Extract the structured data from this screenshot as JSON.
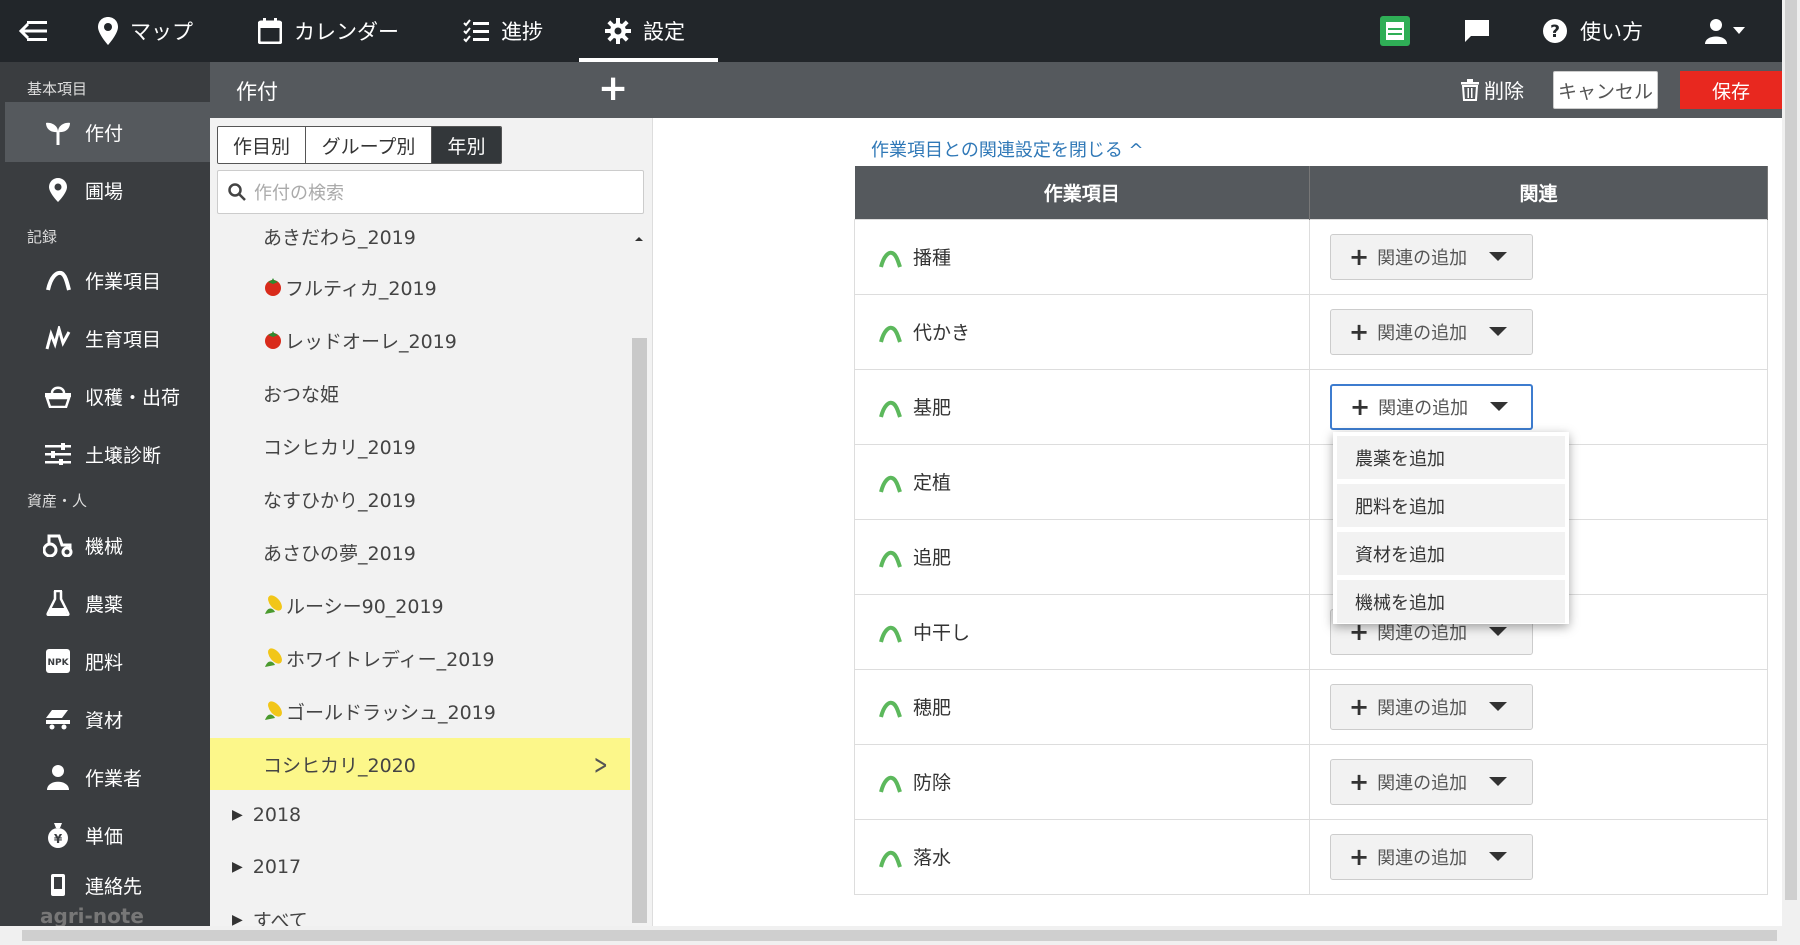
{
  "topbar": {
    "nav": [
      {
        "label": "マップ",
        "icon": "map-pin-icon"
      },
      {
        "label": "カレンダー",
        "icon": "calendar-icon"
      },
      {
        "label": "進捗",
        "icon": "checklist-icon"
      },
      {
        "label": "設定",
        "icon": "gear-icon"
      }
    ],
    "help_label": "使い方"
  },
  "sidebar": {
    "section_basic": "基本項目",
    "section_records": "記録",
    "section_assets": "資産・人",
    "items": [
      {
        "label": "作付",
        "icon": "sprout-icon"
      },
      {
        "label": "圃場",
        "icon": "location-icon"
      },
      {
        "label": "作業項目",
        "icon": "work-icon"
      },
      {
        "label": "生育項目",
        "icon": "growth-icon"
      },
      {
        "label": "収穫・出荷",
        "icon": "basket-icon"
      },
      {
        "label": "土壌診断",
        "icon": "sliders-icon"
      },
      {
        "label": "機械",
        "icon": "tractor-icon"
      },
      {
        "label": "農薬",
        "icon": "flask-icon"
      },
      {
        "label": "肥料",
        "icon": "npk-icon"
      },
      {
        "label": "資材",
        "icon": "material-icon"
      },
      {
        "label": "作業者",
        "icon": "person-icon"
      },
      {
        "label": "単価",
        "icon": "moneybag-icon"
      },
      {
        "label": "連絡先",
        "icon": "phone-icon"
      }
    ],
    "logo": "agri-note"
  },
  "subheader": {
    "title": "作付",
    "delete_label": "削除",
    "cancel_label": "キャンセル",
    "save_label": "保存"
  },
  "crop_panel": {
    "segments": [
      "作目別",
      "グループ別",
      "年別"
    ],
    "search_placeholder": "作付の検索",
    "crops": [
      {
        "name": "あきだわら_2019",
        "icon": ""
      },
      {
        "name": "フルティカ_2019",
        "icon": "tomato"
      },
      {
        "name": "レッドオーレ_2019",
        "icon": "tomato"
      },
      {
        "name": "おつな姫",
        "icon": ""
      },
      {
        "name": "コシヒカリ_2019",
        "icon": ""
      },
      {
        "name": "なすひかり_2019",
        "icon": ""
      },
      {
        "name": "あさひの夢_2019",
        "icon": ""
      },
      {
        "name": "ルーシー90_2019",
        "icon": "corn"
      },
      {
        "name": "ホワイトレディー_2019",
        "icon": "corn"
      },
      {
        "name": "ゴールドラッシュ_2019",
        "icon": "corn"
      },
      {
        "name": "コシヒカリ_2020",
        "icon": "",
        "selected": true
      }
    ],
    "tree": [
      "2018",
      "2017",
      "すべて"
    ]
  },
  "relation": {
    "close_link": "作業項目との関連設定を閉じる ^",
    "col_task": "作業項目",
    "col_relation": "関連",
    "add_label": "関連の追加",
    "rows": [
      "播種",
      "代かき",
      "基肥",
      "定植",
      "追肥",
      "中干し",
      "穂肥",
      "防除",
      "落水"
    ],
    "dropdown": [
      "農薬を追加",
      "肥料を追加",
      "資材を追加",
      "機械を追加"
    ]
  },
  "colors": {
    "accent_green": "#5cb85c",
    "save_red": "#e8281f",
    "selected_yellow": "#fcf78a",
    "link_blue": "#2f78b7"
  }
}
